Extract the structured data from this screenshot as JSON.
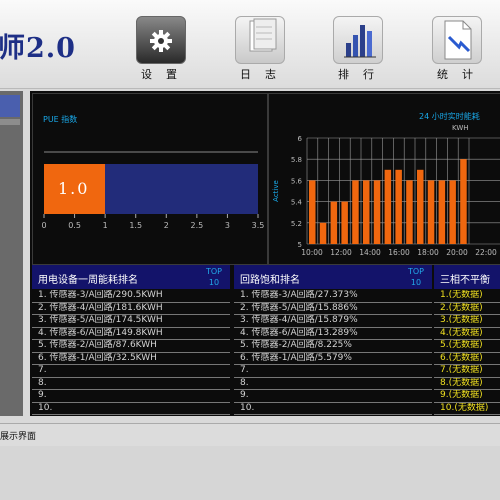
{
  "app": {
    "title": "师2.0"
  },
  "toolbar": [
    {
      "label": "设置",
      "icon": "gear-icon"
    },
    {
      "label": "日志",
      "icon": "notebook-icon"
    },
    {
      "label": "排行",
      "icon": "bar-chart-icon"
    },
    {
      "label": "统计",
      "icon": "document-icon"
    }
  ],
  "pue": {
    "title": "PUE 指数",
    "value_label": "1.0",
    "value": 1.0,
    "axis_ticks": [
      "0",
      "0.5",
      "1",
      "1.5",
      "2",
      "2.5",
      "3",
      "3.5"
    ]
  },
  "chart_data": {
    "type": "bar",
    "title": "24 小时实时能耗",
    "unit": "KWH",
    "ylabel": "Active",
    "ylim": [
      5.0,
      6.0
    ],
    "y_ticks": [
      "5",
      "5.2",
      "5.4",
      "5.6",
      "5.8",
      "6"
    ],
    "x_ticks": [
      "10:00",
      "12:00",
      "14:00",
      "16:00",
      "18:00",
      "20:00",
      "22:00",
      "00"
    ],
    "values": [
      5.6,
      5.2,
      5.4,
      5.4,
      5.6,
      5.6,
      5.6,
      5.7,
      5.7,
      5.6,
      5.7,
      5.6,
      5.6,
      5.6,
      5.8
    ],
    "bar_color": "#f0670f",
    "grid": true
  },
  "tables": [
    {
      "title": "用电设备一周能耗排名",
      "top_label": [
        "TOP",
        "10"
      ],
      "rows": [
        "1. 传感器-3/A回路/290.5KWH",
        "2. 传感器-4/A回路/181.6KWH",
        "3. 传感器-5/A回路/174.5KWH",
        "4. 传感器-6/A回路/149.8KWH",
        "5. 传感器-2/A回路/87.6KWH",
        "6. 传感器-1/A回路/32.5KWH",
        "7.",
        "8.",
        "9.",
        "10."
      ]
    },
    {
      "title": "回路饱和排名",
      "top_label": [
        "TOP",
        "10"
      ],
      "rows": [
        "1. 传感器-3/A回路/27.373%",
        "2. 传感器-5/A回路/15.886%",
        "3. 传感器-4/A回路/15.879%",
        "4. 传感器-6/A回路/13.289%",
        "5. 传感器-2/A回路/8.225%",
        "6. 传感器-1/A回路/5.579%",
        "7.",
        "8.",
        "9.",
        "10."
      ]
    },
    {
      "title": "三相不平衡",
      "rows": [
        "1.(无数据)",
        "2.(无数据)",
        "3.(无数据)",
        "4.(无数据)",
        "5.(无数据)",
        "6.(无数据)",
        "7.(无数据)",
        "8.(无数据)",
        "9.(无数据)",
        "10.(无数据)"
      ]
    }
  ],
  "status": {
    "text": "展示界面"
  }
}
